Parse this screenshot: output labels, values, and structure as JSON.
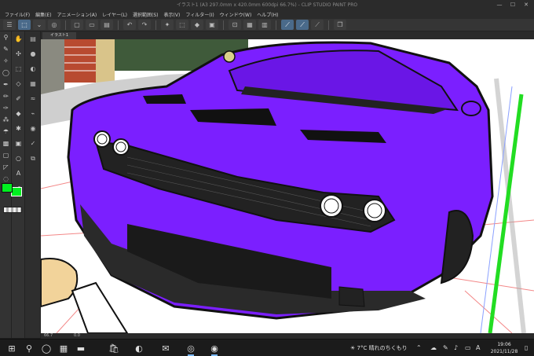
{
  "window": {
    "title": "イラスト1 (A3 297.0mm x 420.0mm 600dpi 66.7%) - CLIP STUDIO PAINT PRO",
    "minimize": "—",
    "maximize": "☐",
    "close": "✕"
  },
  "menu": {
    "items": [
      "ファイル(F)",
      "編集(E)",
      "アニメーション(A)",
      "レイヤー(L)",
      "選択範囲(S)",
      "表示(V)",
      "フィルター(I)",
      "ウィンドウ(W)",
      "ヘルプ(H)"
    ]
  },
  "document": {
    "tab_label": "イラスト1"
  },
  "status": {
    "zoom": "66.7",
    "angle": "0.0"
  },
  "colors": {
    "main_color": "#00f020",
    "sub_color": "#00f020",
    "car_body": "#7b1fff"
  },
  "taskbar": {
    "start": "⊞",
    "search": "⚲",
    "weather_temp": "7°C",
    "weather_text": "晴れのちくもり",
    "ime": "A",
    "time": "19:06",
    "date": "2021/11/28"
  }
}
